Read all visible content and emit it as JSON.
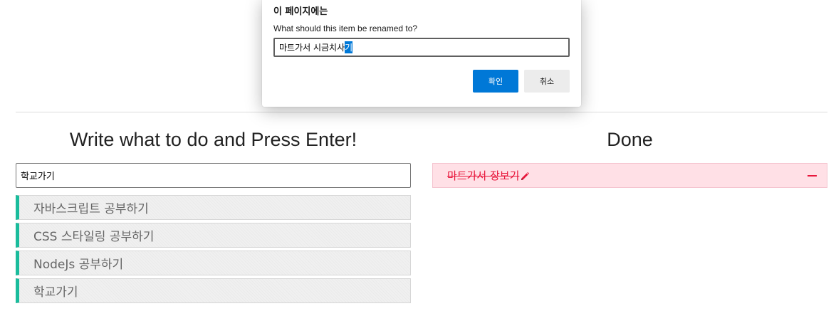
{
  "dialog": {
    "title": "이 페이지에는",
    "message": "What should this item be renamed to?",
    "input_value_unselected": "마트가서 시금치사",
    "input_value_selected": "기",
    "ok_label": "확인",
    "cancel_label": "취소"
  },
  "todo_section": {
    "heading": "Write what to do and Press Enter!",
    "input_value": "학교가기",
    "items": [
      {
        "label": "자바스크립트 공부하기"
      },
      {
        "label": "CSS 스타일링 공부하기"
      },
      {
        "label": "NodeJs 공부하기"
      },
      {
        "label": "학교가기"
      }
    ]
  },
  "done_section": {
    "heading": "Done",
    "items": [
      {
        "label": "마트가서 장보기",
        "edit_icon": "pencil-icon",
        "remove_icon": "minus-icon"
      }
    ]
  },
  "colors": {
    "accent_green": "#1abc9c",
    "done_red": "#e8173c",
    "done_bg": "#ffe0e6",
    "primary_button": "#0078d7"
  }
}
